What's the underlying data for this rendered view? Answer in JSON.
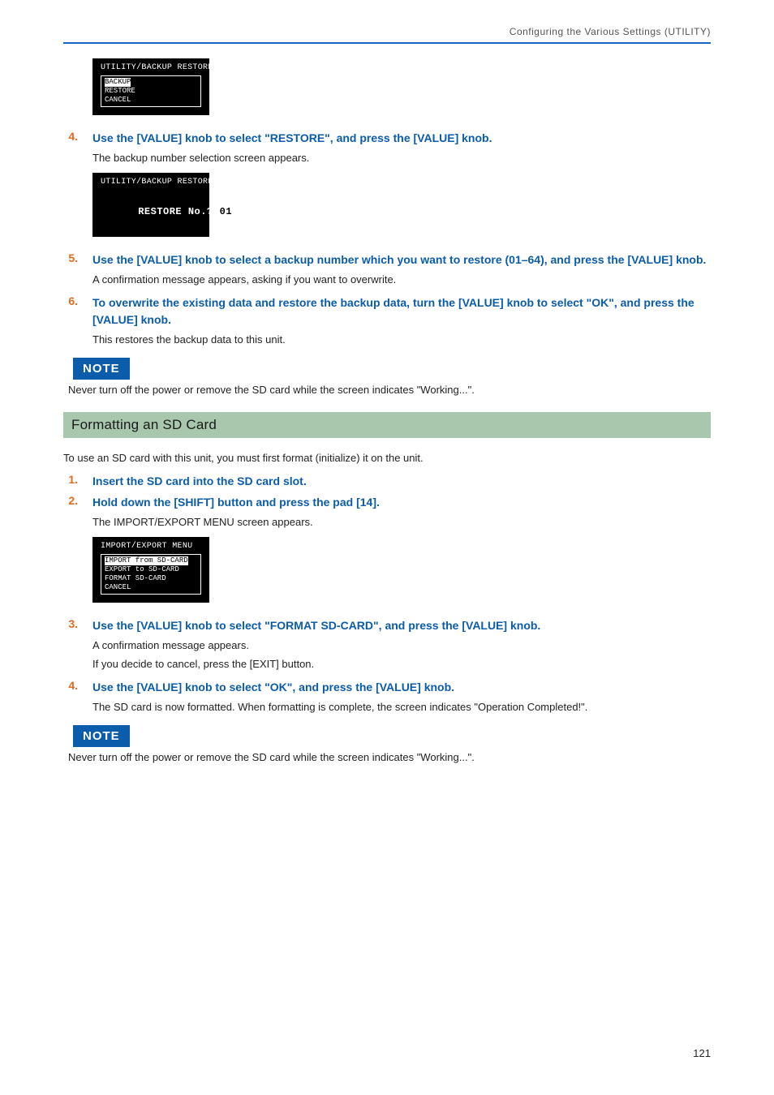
{
  "header": {
    "breadcrumb": "Configuring the Various Settings (UTILITY)"
  },
  "lcd1": {
    "title": "UTILITY/BACKUP RESTORE",
    "items": [
      "BACKUP",
      "RESTORE",
      "CANCEL"
    ],
    "highlight_index": 0
  },
  "step4": {
    "num": "4.",
    "instr": "Use the [VALUE] knob to select \"RESTORE\", and press the [VALUE] knob.",
    "desc": "The backup number selection screen appears."
  },
  "lcd2": {
    "title": "UTILITY/BACKUP RESTORE",
    "line": "RESTORE No.?",
    "value": "01"
  },
  "step5": {
    "num": "5.",
    "instr": "Use the [VALUE] knob to select a backup number which you want to restore (01–64), and press the [VALUE] knob.",
    "desc": "A confirmation message appears, asking if you want to overwrite."
  },
  "step6": {
    "num": "6.",
    "instr": "To overwrite the existing data and restore the backup data, turn the [VALUE] knob to select \"OK\", and press the [VALUE] knob.",
    "desc": "This restores the backup data to this unit."
  },
  "note1": {
    "badge": "NOTE",
    "text": "Never turn off the power or remove the SD card while the screen indicates \"Working...\"."
  },
  "section2": {
    "heading": "Formatting an SD Card",
    "intro": "To use an SD card with this unit, you must first format (initialize) it on the unit."
  },
  "step_s1": {
    "num": "1.",
    "instr": "Insert the SD card into the SD card slot."
  },
  "step_s2": {
    "num": "2.",
    "instr": "Hold down the [SHIFT] button and press the pad [14].",
    "desc": "The IMPORT/EXPORT MENU screen appears."
  },
  "lcd3": {
    "title": "IMPORT/EXPORT MENU",
    "items": [
      "IMPORT from SD-CARD",
      "EXPORT to SD-CARD",
      "FORMAT SD-CARD",
      "CANCEL"
    ],
    "highlight_index": 0
  },
  "step_s3": {
    "num": "3.",
    "instr": "Use the [VALUE] knob to select \"FORMAT SD-CARD\", and press the [VALUE] knob.",
    "desc1": "A confirmation message appears.",
    "desc2": "If you decide to cancel, press the [EXIT] button."
  },
  "step_s4": {
    "num": "4.",
    "instr": "Use the [VALUE] knob to select \"OK\", and press the [VALUE] knob.",
    "desc": "The SD card is now formatted. When formatting is complete, the screen indicates \"Operation Completed!\"."
  },
  "note2": {
    "badge": "NOTE",
    "text": "Never turn off the power or remove the SD card while the screen indicates \"Working...\"."
  },
  "page_number": "121"
}
